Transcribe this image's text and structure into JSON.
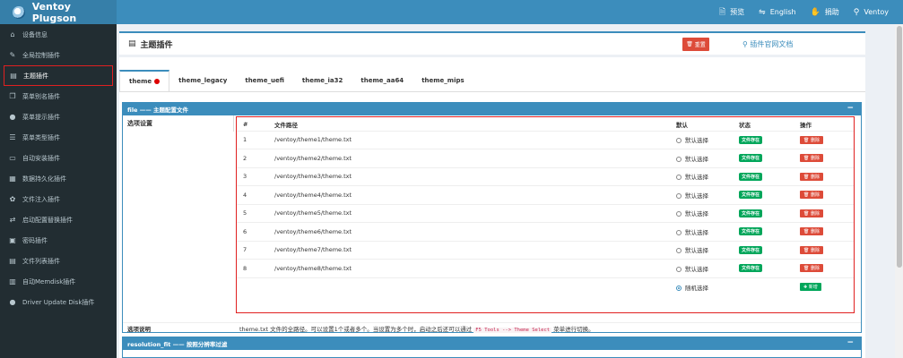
{
  "app": {
    "title": "Ventoy Plugson"
  },
  "topbar": {
    "links": [
      {
        "icon": "preview-icon",
        "glyph": "🗎",
        "label": "预览"
      },
      {
        "icon": "language-icon",
        "glyph": "⇋",
        "label": "English"
      },
      {
        "icon": "donate-icon",
        "glyph": "✋",
        "label": "捐助"
      },
      {
        "icon": "link-icon",
        "glyph": "⚲",
        "label": "Ventoy"
      }
    ]
  },
  "sidebar": {
    "items": [
      {
        "icon": "bank-icon",
        "glyph": "⌂",
        "label": "设备信息"
      },
      {
        "icon": "wrench-icon",
        "glyph": "✎",
        "label": "全局控制插件"
      },
      {
        "icon": "file-icon",
        "glyph": "▤",
        "label": "主题插件",
        "active": true
      },
      {
        "icon": "copy-icon",
        "glyph": "❐",
        "label": "菜单别名插件"
      },
      {
        "icon": "comment-icon",
        "glyph": "●",
        "label": "菜单提示插件"
      },
      {
        "icon": "list-icon",
        "glyph": "☰",
        "label": "菜单类型插件"
      },
      {
        "icon": "monitor-icon",
        "glyph": "▭",
        "label": "自动安装插件"
      },
      {
        "icon": "database-icon",
        "glyph": "▦",
        "label": "数据持久化插件"
      },
      {
        "icon": "gear-icon",
        "glyph": "✿",
        "label": "文件注入插件"
      },
      {
        "icon": "exchange-icon",
        "glyph": "⇄",
        "label": "启动配置替换插件"
      },
      {
        "icon": "lock-icon",
        "glyph": "▣",
        "label": "密码插件"
      },
      {
        "icon": "table-icon",
        "glyph": "▤",
        "label": "文件列表插件"
      },
      {
        "icon": "save-icon",
        "glyph": "▥",
        "label": "自动Memdisk插件"
      },
      {
        "icon": "play-circle-icon",
        "glyph": "●",
        "label": "Driver Update Disk插件"
      }
    ]
  },
  "header": {
    "title": "主题插件",
    "reset_label": "重置",
    "docs_label": "插件官网文档"
  },
  "tabs": [
    "theme",
    "theme_legacy",
    "theme_uefi",
    "theme_ia32",
    "theme_aa64",
    "theme_mips"
  ],
  "panel": {
    "title": "file —— 主题配置文件",
    "option_label": "选项设置",
    "table": {
      "headers": [
        "#",
        "文件路径",
        "默认",
        "状态",
        "操作"
      ],
      "rows": [
        {
          "num": "1",
          "path": "/ventoy/theme1/theme.txt",
          "default": "默认选择",
          "status": "文件存在",
          "action": "删除"
        },
        {
          "num": "2",
          "path": "/ventoy/theme2/theme.txt",
          "default": "默认选择",
          "status": "文件存在",
          "action": "删除"
        },
        {
          "num": "3",
          "path": "/ventoy/theme3/theme.txt",
          "default": "默认选择",
          "status": "文件存在",
          "action": "删除"
        },
        {
          "num": "4",
          "path": "/ventoy/theme4/theme.txt",
          "default": "默认选择",
          "status": "文件存在",
          "action": "删除"
        },
        {
          "num": "5",
          "path": "/ventoy/theme5/theme.txt",
          "default": "默认选择",
          "status": "文件存在",
          "action": "删除"
        },
        {
          "num": "6",
          "path": "/ventoy/theme6/theme.txt",
          "default": "默认选择",
          "status": "文件存在",
          "action": "删除"
        },
        {
          "num": "7",
          "path": "/ventoy/theme7/theme.txt",
          "default": "默认选择",
          "status": "文件存在",
          "action": "删除"
        },
        {
          "num": "8",
          "path": "/ventoy/theme8/theme.txt",
          "default": "默认选择",
          "status": "文件存在",
          "action": "删除"
        }
      ],
      "last_row": {
        "default": "随机选择",
        "action": "新增"
      }
    },
    "desc_label": "选项说明",
    "desc_text_1": "theme.txt 文件的全路径。可以设置1个或者多个。当设置为多个时，启动之后还可以通过",
    "desc_code": "F5 Tools --> Theme Select",
    "desc_text_2": "菜单进行切换。"
  },
  "panel2": {
    "title": "resolution_fit —— 按照分辨率过滤"
  },
  "colors": {
    "primary": "#3c8dbc",
    "sidebar_bg": "#222d32",
    "danger": "#dd4b39",
    "success": "#00a65a",
    "highlight_frame": "#e02020"
  }
}
